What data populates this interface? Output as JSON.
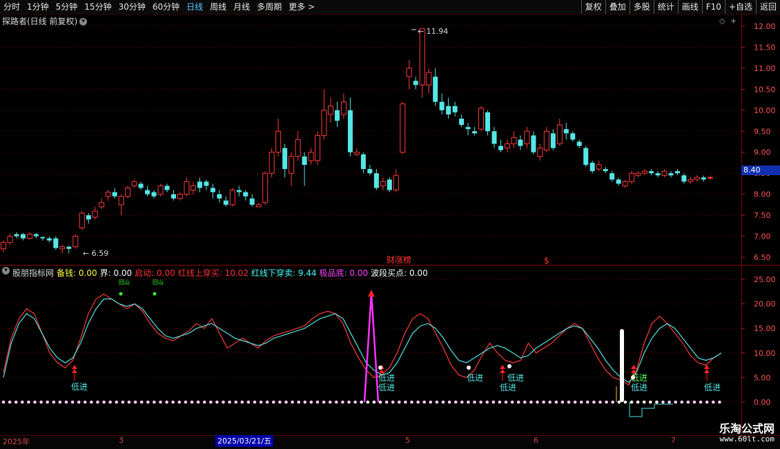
{
  "toolbar": {
    "periods": [
      "分时",
      "1分钟",
      "5分钟",
      "15分钟",
      "30分钟",
      "60分钟",
      "日线",
      "周线",
      "月线",
      "多周期",
      "更多 >"
    ],
    "active_period": "日线",
    "right_buttons": [
      "复权",
      "叠加",
      "多股",
      "统计",
      "画线",
      "F10",
      "+自选",
      "返回"
    ]
  },
  "main_panel": {
    "title": "探路者(日线 前复权)",
    "high_label": "11.94",
    "low_label": "6.59",
    "last_price": "8.40",
    "event_label": "财涨榜",
    "event_mark": "$",
    "y_ticks": [
      "12.00",
      "11.50",
      "11.00",
      "10.50",
      "10.00",
      "9.50",
      "9.00",
      "8.50",
      "8.00",
      "7.50",
      "7.00",
      "6.50"
    ]
  },
  "indicator_panel": {
    "name": "股朋指标网",
    "items": [
      {
        "label": "备钱:",
        "value": "0.00",
        "color": "#ffff44"
      },
      {
        "label": "界:",
        "value": "0.00",
        "color": "#ffffff"
      },
      {
        "label": "启动:",
        "value": "0.00",
        "color": "#ff3333"
      },
      {
        "label": "红线上穿买:",
        "value": "10.02",
        "color": "#ff3333"
      },
      {
        "label": "红线下穿卖:",
        "value": "9.44",
        "color": "#44ffff"
      },
      {
        "label": "极品底:",
        "value": "0.00",
        "color": "#ff44ff"
      },
      {
        "label": "波段买点:",
        "value": "0.00",
        "color": "#ffffff"
      }
    ],
    "y_ticks": [
      "25.00",
      "20.00",
      "15.00",
      "10.00",
      "5.00",
      "0.00"
    ],
    "signal_text": "低进",
    "top_signal_text": "回山"
  },
  "bottom": {
    "dates": [
      "2025年",
      "3",
      "5",
      "6",
      "7"
    ],
    "selected_date": "2025/03/21/五"
  },
  "watermark": {
    "title": "乐淘公式网",
    "url": "www.60lt.com"
  },
  "colors": {
    "up": "#ff3b3b",
    "down": "#55e6e6",
    "grid": "#6a0000",
    "bg": "#000000",
    "accent": "#5ec8ff"
  }
}
